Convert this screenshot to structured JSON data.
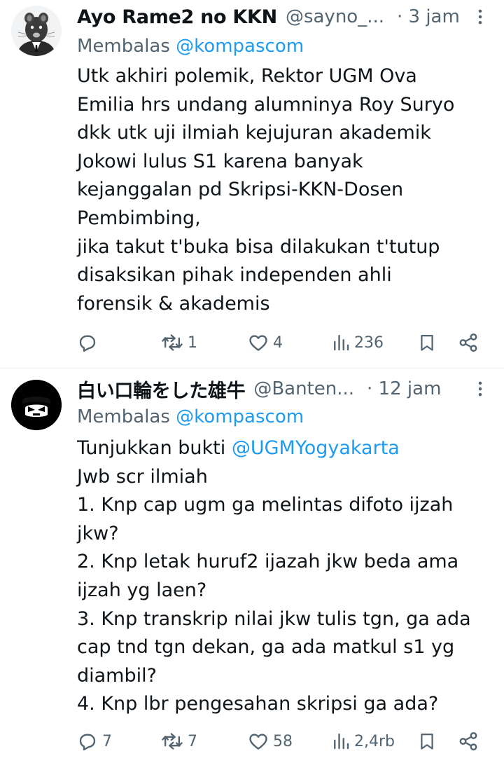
{
  "tweets": [
    {
      "name": "Ayo Rame2 no KKN",
      "handle": "@sayno_...",
      "time": "· 3 jam",
      "reply_prefix": "Membalas",
      "reply_to": "@kompascom",
      "lines": [
        "Utk akhiri polemik, Rektor UGM Ova",
        "Emilia hrs undang alumninya Roy Suryo",
        "dkk utk uji ilmiah kejujuran akademik",
        "Jokowi lulus S1 karena banyak",
        "kejanggalan pd Skripsi-KKN-Dosen",
        "Pembimbing,",
        "jika takut t'buka bisa dilakukan t'tutup",
        "disaksikan pihak independen ahli",
        "forensik & akademis"
      ],
      "stats": {
        "replies": "",
        "reposts": "1",
        "likes": "4",
        "views": "236"
      }
    },
    {
      "name": "白い口輪をした雄牛",
      "handle": "@Banten...",
      "time": "· 12 jam",
      "reply_prefix": "Membalas",
      "reply_to": "@kompascom",
      "line1_prefix": "Tunjukkan bukti ",
      "line1_mention": "@UGMYogyakarta",
      "lines": [
        "Jwb scr ilmiah",
        "1. Knp cap ugm ga melintas difoto ijzah",
        "jkw?",
        "2. Knp letak huruf2 ijazah jkw beda ama",
        "ijzah yg laen?",
        "3. Knp transkrip nilai jkw tulis tgn, ga ada",
        "cap tnd tgn dekan, ga ada matkul s1 yg",
        "diambil?",
        "4. Knp lbr pengesahan skripsi  ga ada?"
      ],
      "stats": {
        "replies": "7",
        "reposts": "7",
        "likes": "58",
        "views": "2,4rb"
      }
    }
  ],
  "colors": {
    "text": "#0f1419",
    "muted": "#536471",
    "link": "#1d9bf0",
    "divider": "#eff3f4"
  },
  "icons": [
    "reply-icon",
    "repost-icon",
    "like-icon",
    "views-icon",
    "bookmark-icon",
    "share-icon",
    "more-icon"
  ]
}
